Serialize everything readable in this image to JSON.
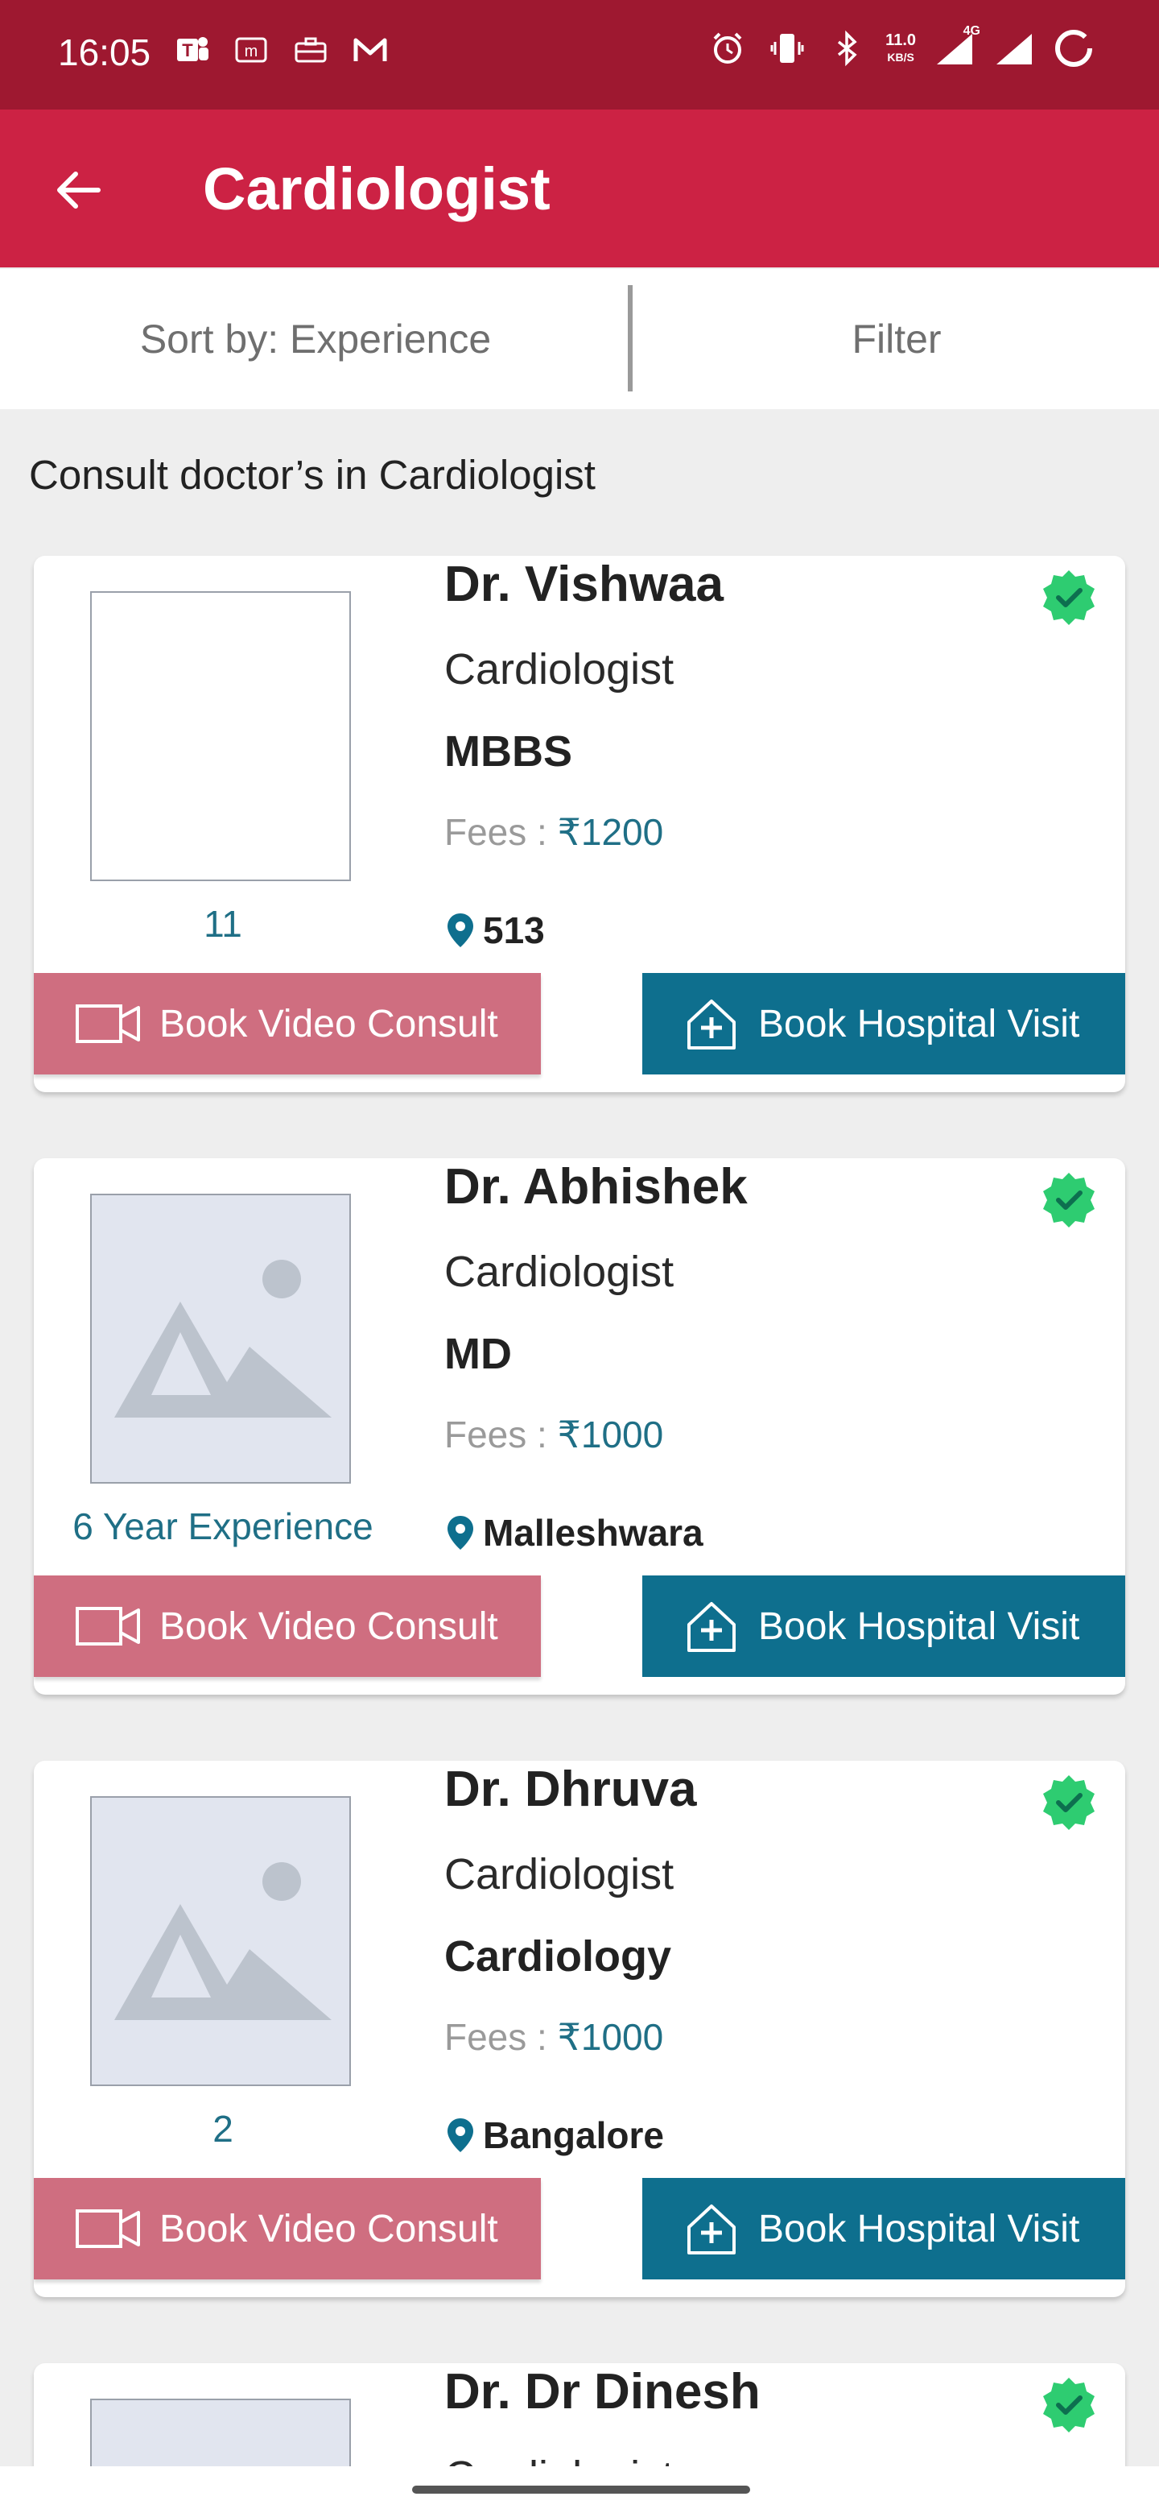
{
  "status_bar": {
    "time": "16:05",
    "left_icons": [
      "teams-icon",
      "m-app-icon",
      "briefcase-icon",
      "gmail-icon"
    ],
    "right_icons": [
      "alarm-icon",
      "vibrate-icon",
      "bluetooth-icon",
      "network-speed-icon",
      "signal-4g-icon",
      "signal-icon",
      "battery-icon"
    ],
    "net_speed_value": "11.0",
    "net_speed_unit": "KB/S",
    "network_type": "4G"
  },
  "app_bar": {
    "title": "Cardiologist",
    "back_icon": "back-arrow-icon"
  },
  "controls": {
    "sort_label": "Sort by: Experience",
    "filter_label": "Filter"
  },
  "section_title": "Consult doctor’s in Cardiologist",
  "doctors": [
    {
      "name": "Dr. Vishwaa",
      "specialty": "Cardiologist",
      "degree": "MBBS",
      "fees_label": "Fees :",
      "fees_amount": "₹1200",
      "caption": "11",
      "location": "513",
      "video_button": "Book Video Consult",
      "hospital_button": "Book Hospital Visit",
      "photo": "blank"
    },
    {
      "name": "Dr. Abhishek",
      "specialty": "Cardiologist",
      "degree": "MD",
      "fees_label": "Fees :",
      "fees_amount": "₹1000",
      "caption": "6 Year  Experience",
      "location": "Malleshwara",
      "video_button": "Book Video Consult",
      "hospital_button": "Book Hospital Visit",
      "photo": "placeholder"
    },
    {
      "name": "Dr. Dhruva",
      "specialty": "Cardiologist",
      "degree": "Cardiology",
      "fees_label": "Fees :",
      "fees_amount": "₹1000",
      "caption": "2",
      "location": "Bangalore",
      "video_button": "Book Video Consult",
      "hospital_button": "Book Hospital Visit",
      "photo": "placeholder"
    },
    {
      "name": "Dr.  Dr Dinesh",
      "specialty": "Cardiologist",
      "photo": "placeholder"
    }
  ],
  "colors": {
    "status_bar": "#9e1830",
    "app_bar": "#cc2244",
    "video_button": "#cf6e80",
    "hospital_button": "#0e6f8e",
    "accent_text": "#1f6f86",
    "verified_badge": "#2ecc71"
  }
}
